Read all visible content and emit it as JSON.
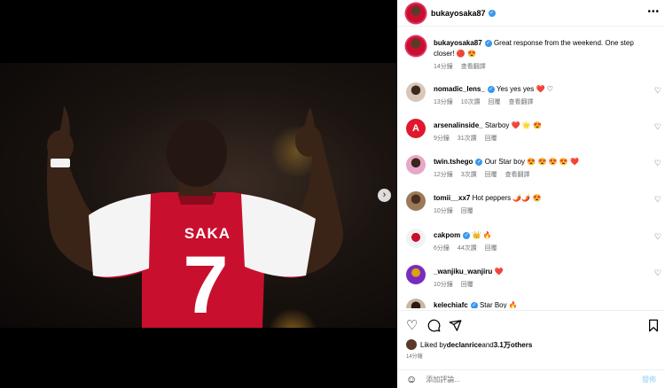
{
  "header": {
    "username": "bukayosaka87"
  },
  "caption": {
    "username": "bukayosaka87",
    "text": "Great response from the weekend. One step closer! 🔴 😍",
    "time": "14分鐘",
    "translate": "查看翻譯"
  },
  "comments": [
    {
      "username": "nomadic_lens_",
      "verified": true,
      "text": "Yes yes yes ❤️ ♡",
      "time": "13分鐘",
      "likes": "10次讚",
      "reply": "回覆",
      "translate": "查看翻譯"
    },
    {
      "username": "arsenalinside_",
      "verified": false,
      "text": "Starboy ❤️ 🌟 😍",
      "time": "9分鐘",
      "likes": "31次讚",
      "reply": "回覆",
      "translate": ""
    },
    {
      "username": "twin.tshego",
      "verified": true,
      "text": "Our Star boy 😍 😍 😍 😍 ❤️",
      "time": "12分鐘",
      "likes": "3次讚",
      "reply": "回覆",
      "translate": "查看翻譯"
    },
    {
      "username": "tomii__xx7",
      "verified": false,
      "text": "Hot peppers 🌶️🌶️ 😍",
      "time": "10分鐘",
      "likes": "",
      "reply": "回覆",
      "translate": ""
    },
    {
      "username": "cakpom",
      "verified": true,
      "text": "👑 🔥",
      "time": "6分鐘",
      "likes": "44次讚",
      "reply": "回覆",
      "translate": ""
    },
    {
      "username": "_wanjiku_wanjiru",
      "verified": false,
      "text": "❤️",
      "time": "10分鐘",
      "likes": "",
      "reply": "回覆",
      "translate": ""
    },
    {
      "username": "kelechiafc",
      "verified": true,
      "text": "Star Boy 🔥",
      "time": "",
      "likes": "",
      "reply": "",
      "translate": ""
    }
  ],
  "likes_summary": {
    "prefix": "Liked by ",
    "user": "declanrice",
    "and": "and ",
    "count": "3.1万",
    "suffix": " others"
  },
  "post_time": "14分鐘",
  "comment_box": {
    "placeholder": "添加評論...",
    "post_label": "發佈"
  },
  "icons": {
    "more": "more-horizontal-icon",
    "heart": "heart-icon",
    "comment": "comment-icon",
    "share": "share-icon",
    "bookmark": "bookmark-icon",
    "emoji": "emoji-icon",
    "next": "chevron-right-icon"
  },
  "colors": {
    "verified": "#3897f0",
    "arsenal_red": "#c8102e",
    "post_button": "#b2dffc",
    "meta_text": "#737373"
  }
}
